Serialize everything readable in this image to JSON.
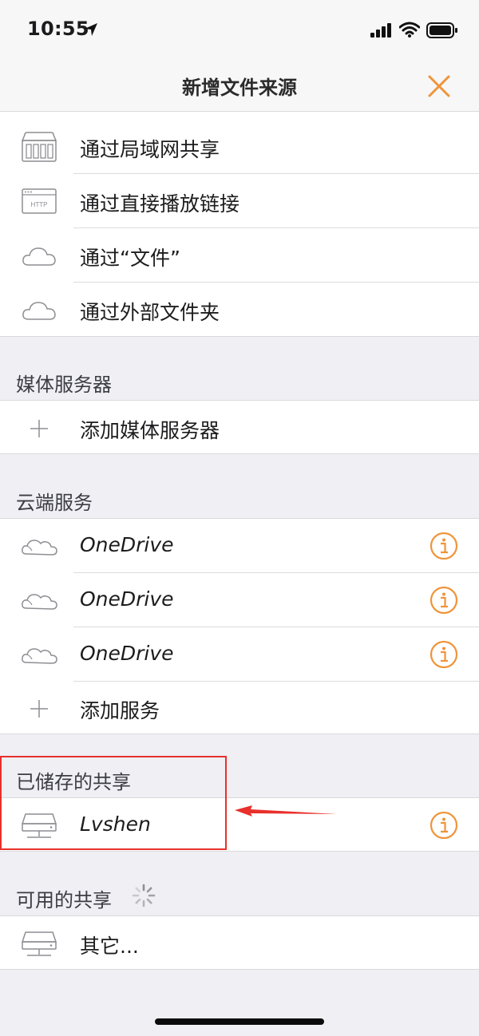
{
  "status_bar": {
    "time": "10:55"
  },
  "nav": {
    "title": "新增文件来源"
  },
  "sources": [
    {
      "label": "通过局域网共享",
      "icon": "nas-icon"
    },
    {
      "label": "通过直接播放链接",
      "icon": "http-icon"
    },
    {
      "label": "通过“文件”",
      "icon": "cloud-icon"
    },
    {
      "label": "通过外部文件夹",
      "icon": "cloud-icon"
    }
  ],
  "media_servers": {
    "header": "媒体服务器",
    "add_label": "添加媒体服务器"
  },
  "cloud_services": {
    "header": "云端服务",
    "items": [
      {
        "label": "OneDrive"
      },
      {
        "label": "OneDrive"
      },
      {
        "label": "OneDrive"
      }
    ],
    "add_label": "添加服务"
  },
  "saved_shares": {
    "header": "已储存的共享",
    "items": [
      {
        "label": "Lvshen"
      }
    ]
  },
  "available_shares": {
    "header": "可用的共享",
    "items": [
      {
        "label": "其它..."
      }
    ]
  },
  "colors": {
    "accent": "#f0943a",
    "annotation": "#e8302c",
    "background": "#efeff4"
  }
}
